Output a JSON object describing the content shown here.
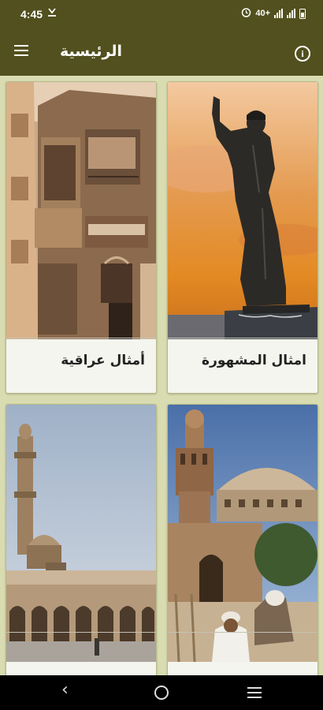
{
  "status_bar": {
    "time": "4:45",
    "network": "40+",
    "icons": [
      "download-icon",
      "alarm-icon",
      "signal-icon",
      "battery-icon"
    ]
  },
  "app_bar": {
    "title": "الرئيسية",
    "menu_icon": "menu-icon",
    "info_icon": "info-icon",
    "info_glyph": "i",
    "background": "#51501e"
  },
  "cards": [
    {
      "title": "امثال المشهورة",
      "image": "statue-image"
    },
    {
      "title": "أمثال عراقية",
      "image": "old-building-image"
    },
    {
      "title": "",
      "image": "minaret-dome-image"
    },
    {
      "title": "",
      "image": "mosque-courtyard-image"
    }
  ],
  "colors": {
    "grid_background": "#d9dcb0",
    "card_background": "#f4f5ef"
  },
  "nav_bar": {
    "back_glyph": "‹",
    "icons": [
      "back-icon",
      "home-icon",
      "recents-icon"
    ]
  }
}
